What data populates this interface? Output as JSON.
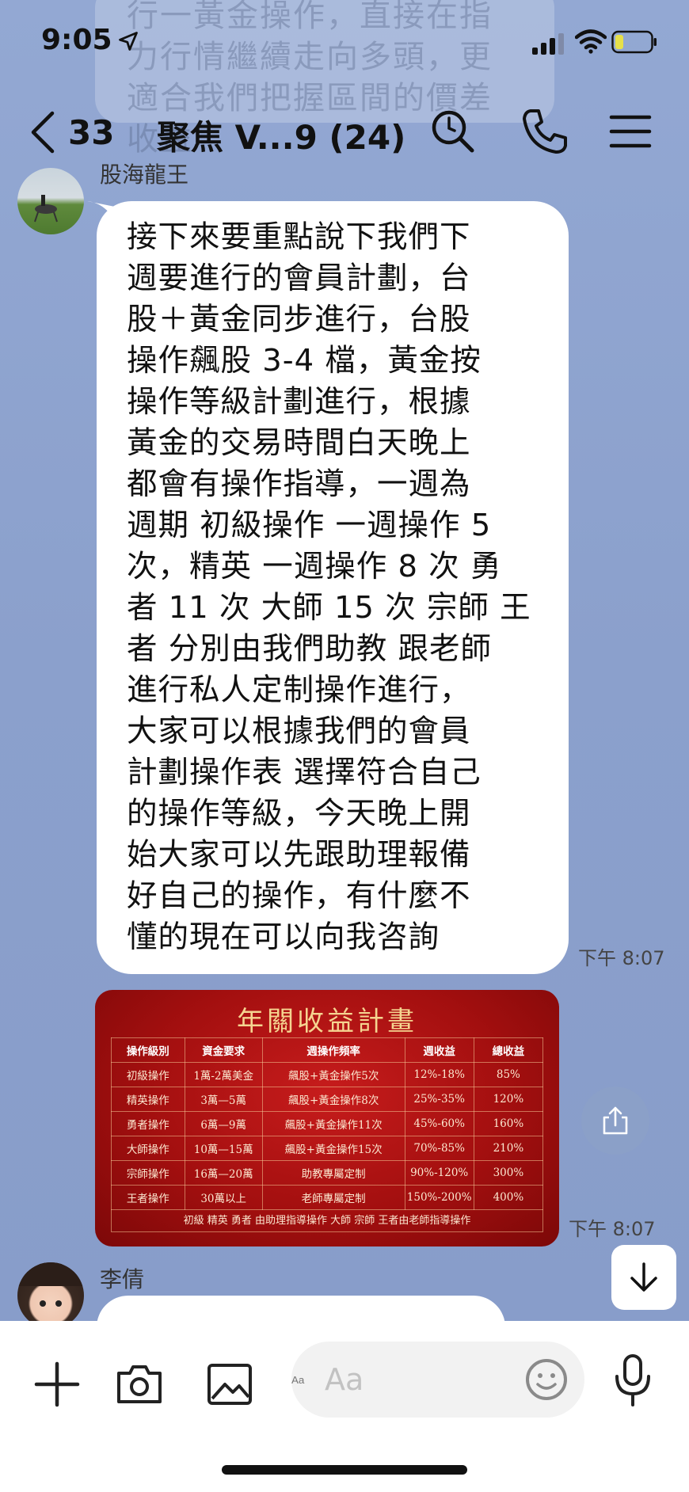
{
  "status_bar": {
    "time": "9:05"
  },
  "header": {
    "back_count": "33",
    "title": "聚焦 V...9 (24)"
  },
  "background_text": "行一黃金操作，直接在指\n力行情繼續走向多頭，更\n適合我們把握區間的價差\n收益",
  "messages": [
    {
      "sender": "股海龍王",
      "text": "接下來要重點說下我們下\n週要進行的會員計劃，台\n股＋黃金同步進行，台股\n操作飆股 3-4 檔，黃金按\n操作等級計劃進行，根據\n黃金的交易時間白天晚上\n都會有操作指導，一週為\n週期 初級操作 一週操作 5\n次，精英 一週操作 8 次 勇\n者 11 次 大師 15 次 宗師 王\n者 分別由我們助教 跟老師\n進行私人定制操作進行，\n大家可以根據我們的會員\n計劃操作表 選擇符合自己\n的操作等級，今天晚上開\n始大家可以先跟助理報備\n好自己的操作，有什麼不\n懂的現在可以向我咨詢",
      "time": "下午 8:07"
    },
    {
      "image": {
        "title": "年關收益計畫",
        "headers": [
          "操作級別",
          "資金要求",
          "週操作頻率",
          "週收益",
          "總收益"
        ],
        "rows": [
          [
            "初級操作",
            "1萬-2萬美金",
            "飆股+黃金操作5次",
            "12%-18%",
            "85%"
          ],
          [
            "精英操作",
            "3萬—5萬",
            "飆股+黃金操作8次",
            "25%-35%",
            "120%"
          ],
          [
            "勇者操作",
            "6萬—9萬",
            "飆股+黃金操作11次",
            "45%-60%",
            "160%"
          ],
          [
            "大師操作",
            "10萬—15萬",
            "飆股+黃金操作15次",
            "70%-85%",
            "210%"
          ],
          [
            "宗師操作",
            "16萬—20萬",
            "助教專屬定制",
            "90%-120%",
            "300%"
          ],
          [
            "王者操作",
            "30萬以上",
            "老師專屬定制",
            "150%-200%",
            "400%"
          ]
        ],
        "footer": "初級 精英 勇者 由助理指導操作 大師 宗師 王者由老師指導操作"
      },
      "time": "下午 8:07"
    },
    {
      "sender": "李倩"
    }
  ],
  "input": {
    "placeholder": "Aa"
  },
  "icons": {
    "location": "location-arrow-icon",
    "signal": "cellular-signal-icon",
    "wifi": "wifi-icon",
    "battery": "battery-icon",
    "back": "chevron-left-icon",
    "search": "search-icon",
    "call": "phone-icon",
    "menu": "menu-icon",
    "share": "share-icon",
    "scroll_down": "arrow-down-icon",
    "add": "plus-icon",
    "camera": "camera-icon",
    "gallery": "image-icon",
    "emoji": "emoji-icon",
    "mic": "microphone-icon"
  },
  "colors": {
    "chat_background": "#8ea3cf",
    "bubble": "#ffffff",
    "image_red": "#a30f0f",
    "image_gold": "#f5d490"
  }
}
